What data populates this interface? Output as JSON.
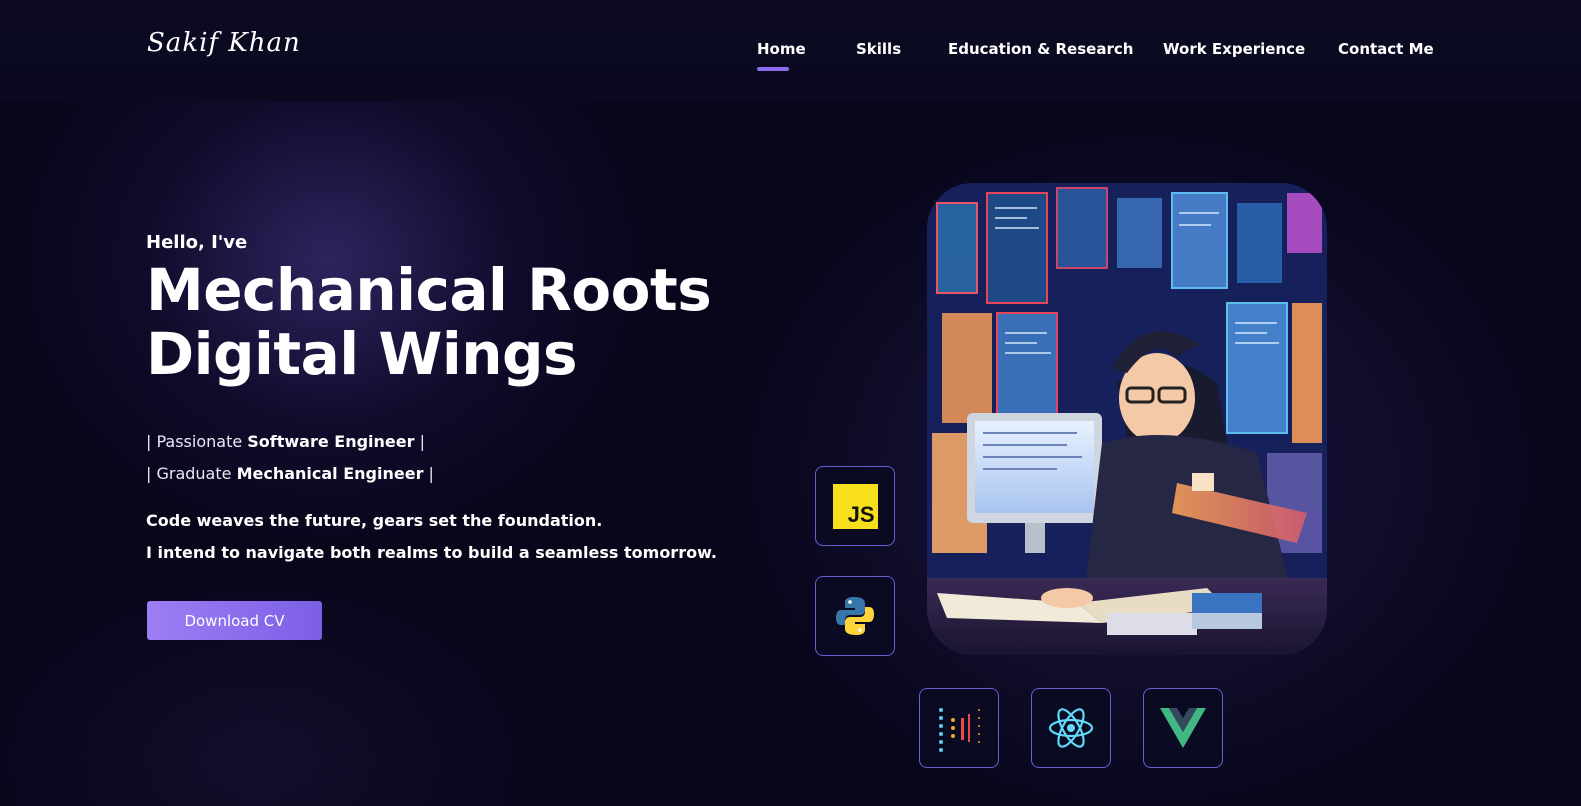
{
  "header": {
    "logo": "Sakif Khan",
    "nav": [
      {
        "label": "Home",
        "active": true
      },
      {
        "label": "Skills"
      },
      {
        "label": "Education & Research"
      },
      {
        "label": "Work Experience"
      },
      {
        "label": "Contact Me"
      }
    ]
  },
  "hero": {
    "greeting": "Hello, I've",
    "title_line1": "Mechanical Roots",
    "title_line2": "Digital Wings",
    "role1_prefix": "| Passionate ",
    "role1_bold": "Software Engineer",
    "role1_suffix": " |",
    "role2_prefix": "| Graduate ",
    "role2_bold": "Mechanical Engineer",
    "role2_suffix": " |",
    "tagline1": "Code weaves the future, gears set the foundation.",
    "tagline2": "I intend to navigate both realms to build a seamless tomorrow.",
    "cta": "Download CV"
  },
  "tech_icons": [
    {
      "name": "javascript-icon",
      "label": "JS"
    },
    {
      "name": "python-icon"
    },
    {
      "name": "data-viz-icon"
    },
    {
      "name": "react-icon"
    },
    {
      "name": "vue-icon"
    }
  ],
  "colors": {
    "background": "#07061a",
    "accent": "#8b6cf0",
    "button": "#8a6df0",
    "js_yellow": "#f7df1e",
    "react_cyan": "#61dafb",
    "vue_green": "#41b883"
  }
}
